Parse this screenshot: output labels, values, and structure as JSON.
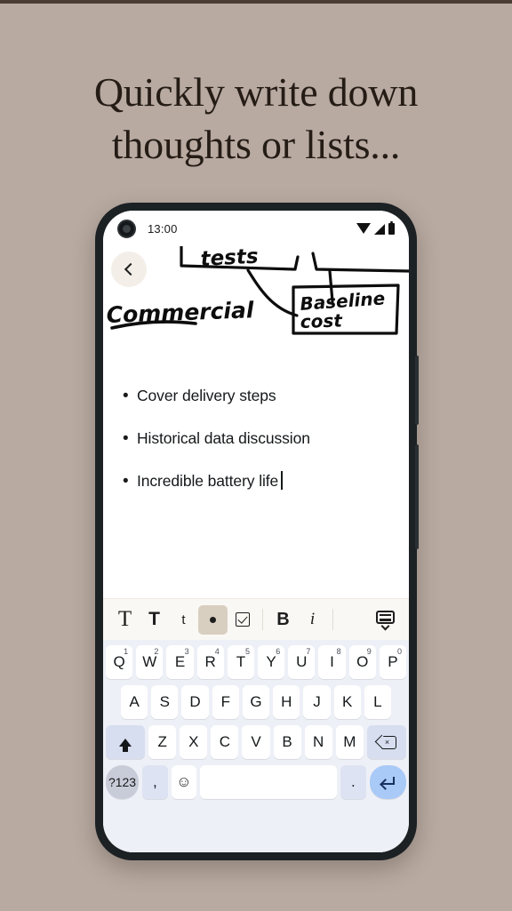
{
  "promo": {
    "headline_line1": "Quickly write down",
    "headline_line2": "thoughts or lists...",
    "background_color": "#b8aaa1",
    "text_color": "#251c16"
  },
  "phone": {
    "status_bar": {
      "time": "13:00",
      "icons": [
        "wifi-icon",
        "signal-icon",
        "battery-icon"
      ]
    },
    "nav": {
      "back_label": "‹"
    },
    "sketch": {
      "handwritten_labels": [
        "tests",
        "Commercial",
        "Baseline cost"
      ]
    },
    "note": {
      "bullets": [
        {
          "marker": "•",
          "text": "Cover delivery steps"
        },
        {
          "marker": "•",
          "text": "Historical data discussion"
        },
        {
          "marker": "•",
          "text": "Incredible battery life"
        }
      ],
      "caret_after_index": 2
    },
    "format_toolbar": {
      "background": "#faf8f4",
      "selected_color": "#d9cfc1",
      "items": [
        {
          "name": "heading-large",
          "label": "T"
        },
        {
          "name": "heading-medium",
          "label": "T"
        },
        {
          "name": "heading-small",
          "label": "t"
        },
        {
          "name": "bullet-list",
          "label": "•",
          "selected": true
        },
        {
          "name": "checklist",
          "label": "☑"
        },
        {
          "name": "bold",
          "label": "B"
        },
        {
          "name": "italic",
          "label": "i"
        },
        {
          "name": "hide-keyboard",
          "label": "⌨"
        }
      ]
    },
    "keyboard": {
      "background": "#eef0f7",
      "row1": [
        {
          "key": "Q",
          "sup": "1"
        },
        {
          "key": "W",
          "sup": "2"
        },
        {
          "key": "E",
          "sup": "3"
        },
        {
          "key": "R",
          "sup": "4"
        },
        {
          "key": "T",
          "sup": "5"
        },
        {
          "key": "Y",
          "sup": "6"
        },
        {
          "key": "U",
          "sup": "7"
        },
        {
          "key": "I",
          "sup": "8"
        },
        {
          "key": "O",
          "sup": "9"
        },
        {
          "key": "P",
          "sup": "0"
        }
      ],
      "row2": [
        "A",
        "S",
        "D",
        "F",
        "G",
        "H",
        "J",
        "K",
        "L"
      ],
      "row3": [
        "Z",
        "X",
        "C",
        "V",
        "B",
        "N",
        "M"
      ],
      "shift_label": "shift",
      "backspace_label": "⌫",
      "row4": {
        "symbols_label": "?123",
        "comma_label": ",",
        "emoji_label": "☺",
        "space_label": "",
        "period_label": ".",
        "enter_label": "↵"
      }
    },
    "footer": {
      "dismiss_label": "⌄",
      "home_indicator": true
    }
  }
}
